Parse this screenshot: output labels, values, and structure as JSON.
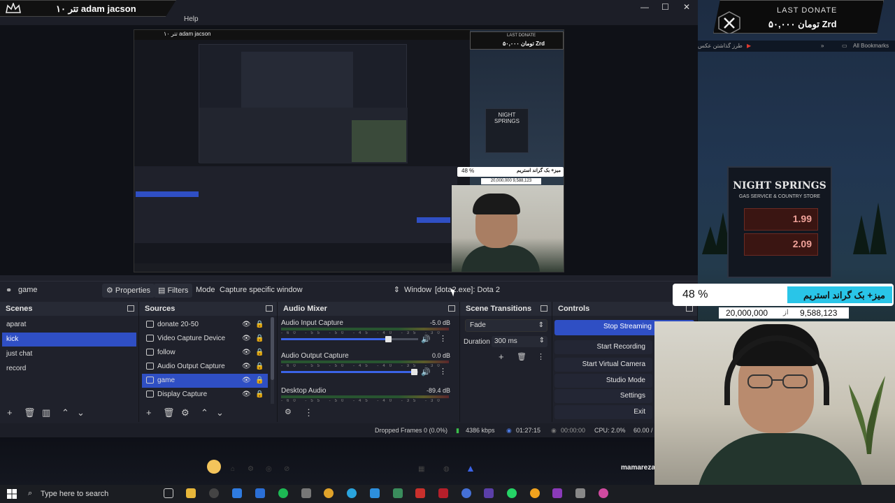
{
  "stream_overlay": {
    "name_tag": "۱۰ تتر adam jacson",
    "donate_title": "LAST DONATE",
    "donate_value": "۵۰,۰۰۰ تومان Zrd",
    "goal_percent": "48 %",
    "goal_title": "میز+ بک گراند استریم",
    "goal_target": "20,000,000",
    "goal_of": "از",
    "goal_current": "9,588,123"
  },
  "preview": {
    "nested_name": "۱۰ تتر adam jacson",
    "nested_donate_title": "LAST DONATE",
    "nested_donate_value": "۵۰,۰۰۰ تومان Zrd",
    "nested_goal_percent": "48 %",
    "nested_goal_title": "میز+ بک گراند استریم",
    "nested_goal_line": "20,000,000   9,588,123",
    "billboard_line1": "NIGHT SPRINGS",
    "billboard_line2": "GAS SERVICE & COUNTRY STORE"
  },
  "menubar": {
    "help": "Help"
  },
  "window_controls": {
    "minimize": "—",
    "maximize": "☐",
    "close": "✕"
  },
  "toolbar": {
    "source_name": "game",
    "properties": "Properties",
    "filters": "Filters",
    "mode_label": "Mode",
    "mode_value": "Capture specific window",
    "window_label": "Window",
    "window_value": "[dota2.exe]: Dota 2"
  },
  "scenes": {
    "title": "Scenes",
    "items": [
      "aparat",
      "kick",
      "just chat",
      "record"
    ],
    "selected_index": 1
  },
  "sources": {
    "title": "Sources",
    "items": [
      "donate 20-50",
      "Video Capture Device",
      "follow",
      "Audio Output Capture",
      "game",
      "Display Capture"
    ],
    "selected_index": 4
  },
  "audio_mixer": {
    "title": "Audio Mixer",
    "channels": [
      {
        "name": "Audio Input Capture",
        "db": "-5.0 dB",
        "volume": 0.78
      },
      {
        "name": "Audio Output Capture",
        "db": "0.0 dB",
        "volume": 0.97
      },
      {
        "name": "Desktop Audio",
        "db": "-89.4 dB"
      }
    ],
    "ticks": "-60 -55 -50 -45 -40 -35 -30 -25 -20 -15 -10 -5 0"
  },
  "scene_transitions": {
    "title": "Scene Transitions",
    "transition": "Fade",
    "duration_label": "Duration",
    "duration_value": "300 ms"
  },
  "controls": {
    "title": "Controls",
    "stop_streaming": "Stop Streaming",
    "start_recording": "Start Recording",
    "start_virtual_camera": "Start Virtual Camera",
    "studio_mode": "Studio Mode",
    "settings": "Settings",
    "exit": "Exit"
  },
  "status": {
    "dropped_frames": "Dropped Frames 0 (0.0%)",
    "bitrate": "4386 kbps",
    "live_time": "01:27:15",
    "rec_time": "00:00:00",
    "cpu": "CPU: 2.0%",
    "fps": "60.00 /"
  },
  "browser": {
    "bookmark_folder": "طرز گذاشتن عکس",
    "all_bookmarks": "All Bookmarks"
  },
  "desktop": {
    "username": "mamareza"
  },
  "taskbar": {
    "search_placeholder": "Type here to search"
  },
  "colors": {
    "accent": "#2f4fc4",
    "panel": "#1f212b",
    "goal_highlight": "#29c5e8"
  }
}
